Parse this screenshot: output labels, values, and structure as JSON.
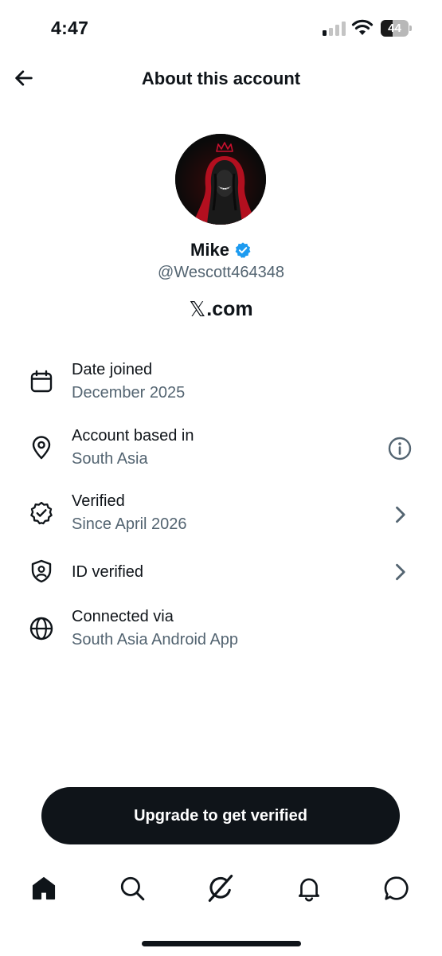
{
  "status_bar": {
    "time": "4:47",
    "battery_level": "44",
    "battery_fraction": 0.44
  },
  "header": {
    "title": "About this account",
    "back_icon": "arrow-left-icon"
  },
  "profile": {
    "name": "Mike",
    "handle": "@Wescott464348",
    "verified_badge_color": "#1d9bf0",
    "site_prefix": "𝕏",
    "site_suffix": ".com"
  },
  "info_rows": [
    {
      "icon": "calendar-icon",
      "title": "Date joined",
      "subtitle": "December 2025",
      "action": null
    },
    {
      "icon": "location-pin-icon",
      "title": "Account based in",
      "subtitle": "South Asia",
      "action": "info-icon"
    },
    {
      "icon": "verified-check-icon",
      "title": "Verified",
      "subtitle": "Since April 2026",
      "action": "chevron-right-icon"
    },
    {
      "icon": "id-shield-icon",
      "title": "ID verified",
      "subtitle": "",
      "action": "chevron-right-icon"
    },
    {
      "icon": "globe-icon",
      "title": "Connected via",
      "subtitle": "South Asia Android App",
      "action": null
    }
  ],
  "cta": {
    "label": "Upgrade to get verified"
  },
  "tab_bar": {
    "tabs": [
      "home-icon",
      "search-icon",
      "grok-icon",
      "notifications-bell-icon",
      "messages-icon"
    ],
    "active": "home-icon"
  },
  "colors": {
    "text_primary": "#0f1419",
    "text_secondary": "#536471",
    "accent": "#1d9bf0",
    "button_bg": "#0f1419"
  }
}
